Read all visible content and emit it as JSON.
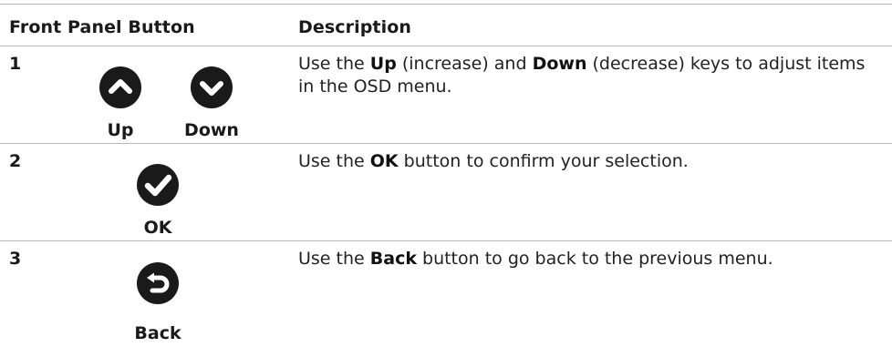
{
  "table": {
    "headers": {
      "button": "Front Panel Button",
      "description": "Description"
    },
    "rows": [
      {
        "number": "1",
        "buttons": [
          {
            "label": "Up",
            "icon": "chevron-up-icon"
          },
          {
            "label": "Down",
            "icon": "chevron-down-icon"
          }
        ],
        "description": {
          "part1": "Use the ",
          "bold1": "Up",
          "part2": " (increase) and ",
          "bold2": "Down",
          "part3": " (decrease) keys to adjust items in the OSD menu."
        }
      },
      {
        "number": "2",
        "buttons": [
          {
            "label": "OK",
            "icon": "checkmark-icon"
          }
        ],
        "description": {
          "part1": "Use the ",
          "bold1": "OK",
          "part2": " button to confirm your selection."
        }
      },
      {
        "number": "3",
        "buttons": [
          {
            "label": "Back",
            "icon": "back-arrow-icon"
          }
        ],
        "description": {
          "part1": "Use the ",
          "bold1": "Back",
          "part2": " button to go back to the previous menu."
        }
      }
    ]
  },
  "colors": {
    "icon_fill": "#1a1a1a",
    "icon_glyph": "#ffffff",
    "rule": "#b9b9b9"
  }
}
